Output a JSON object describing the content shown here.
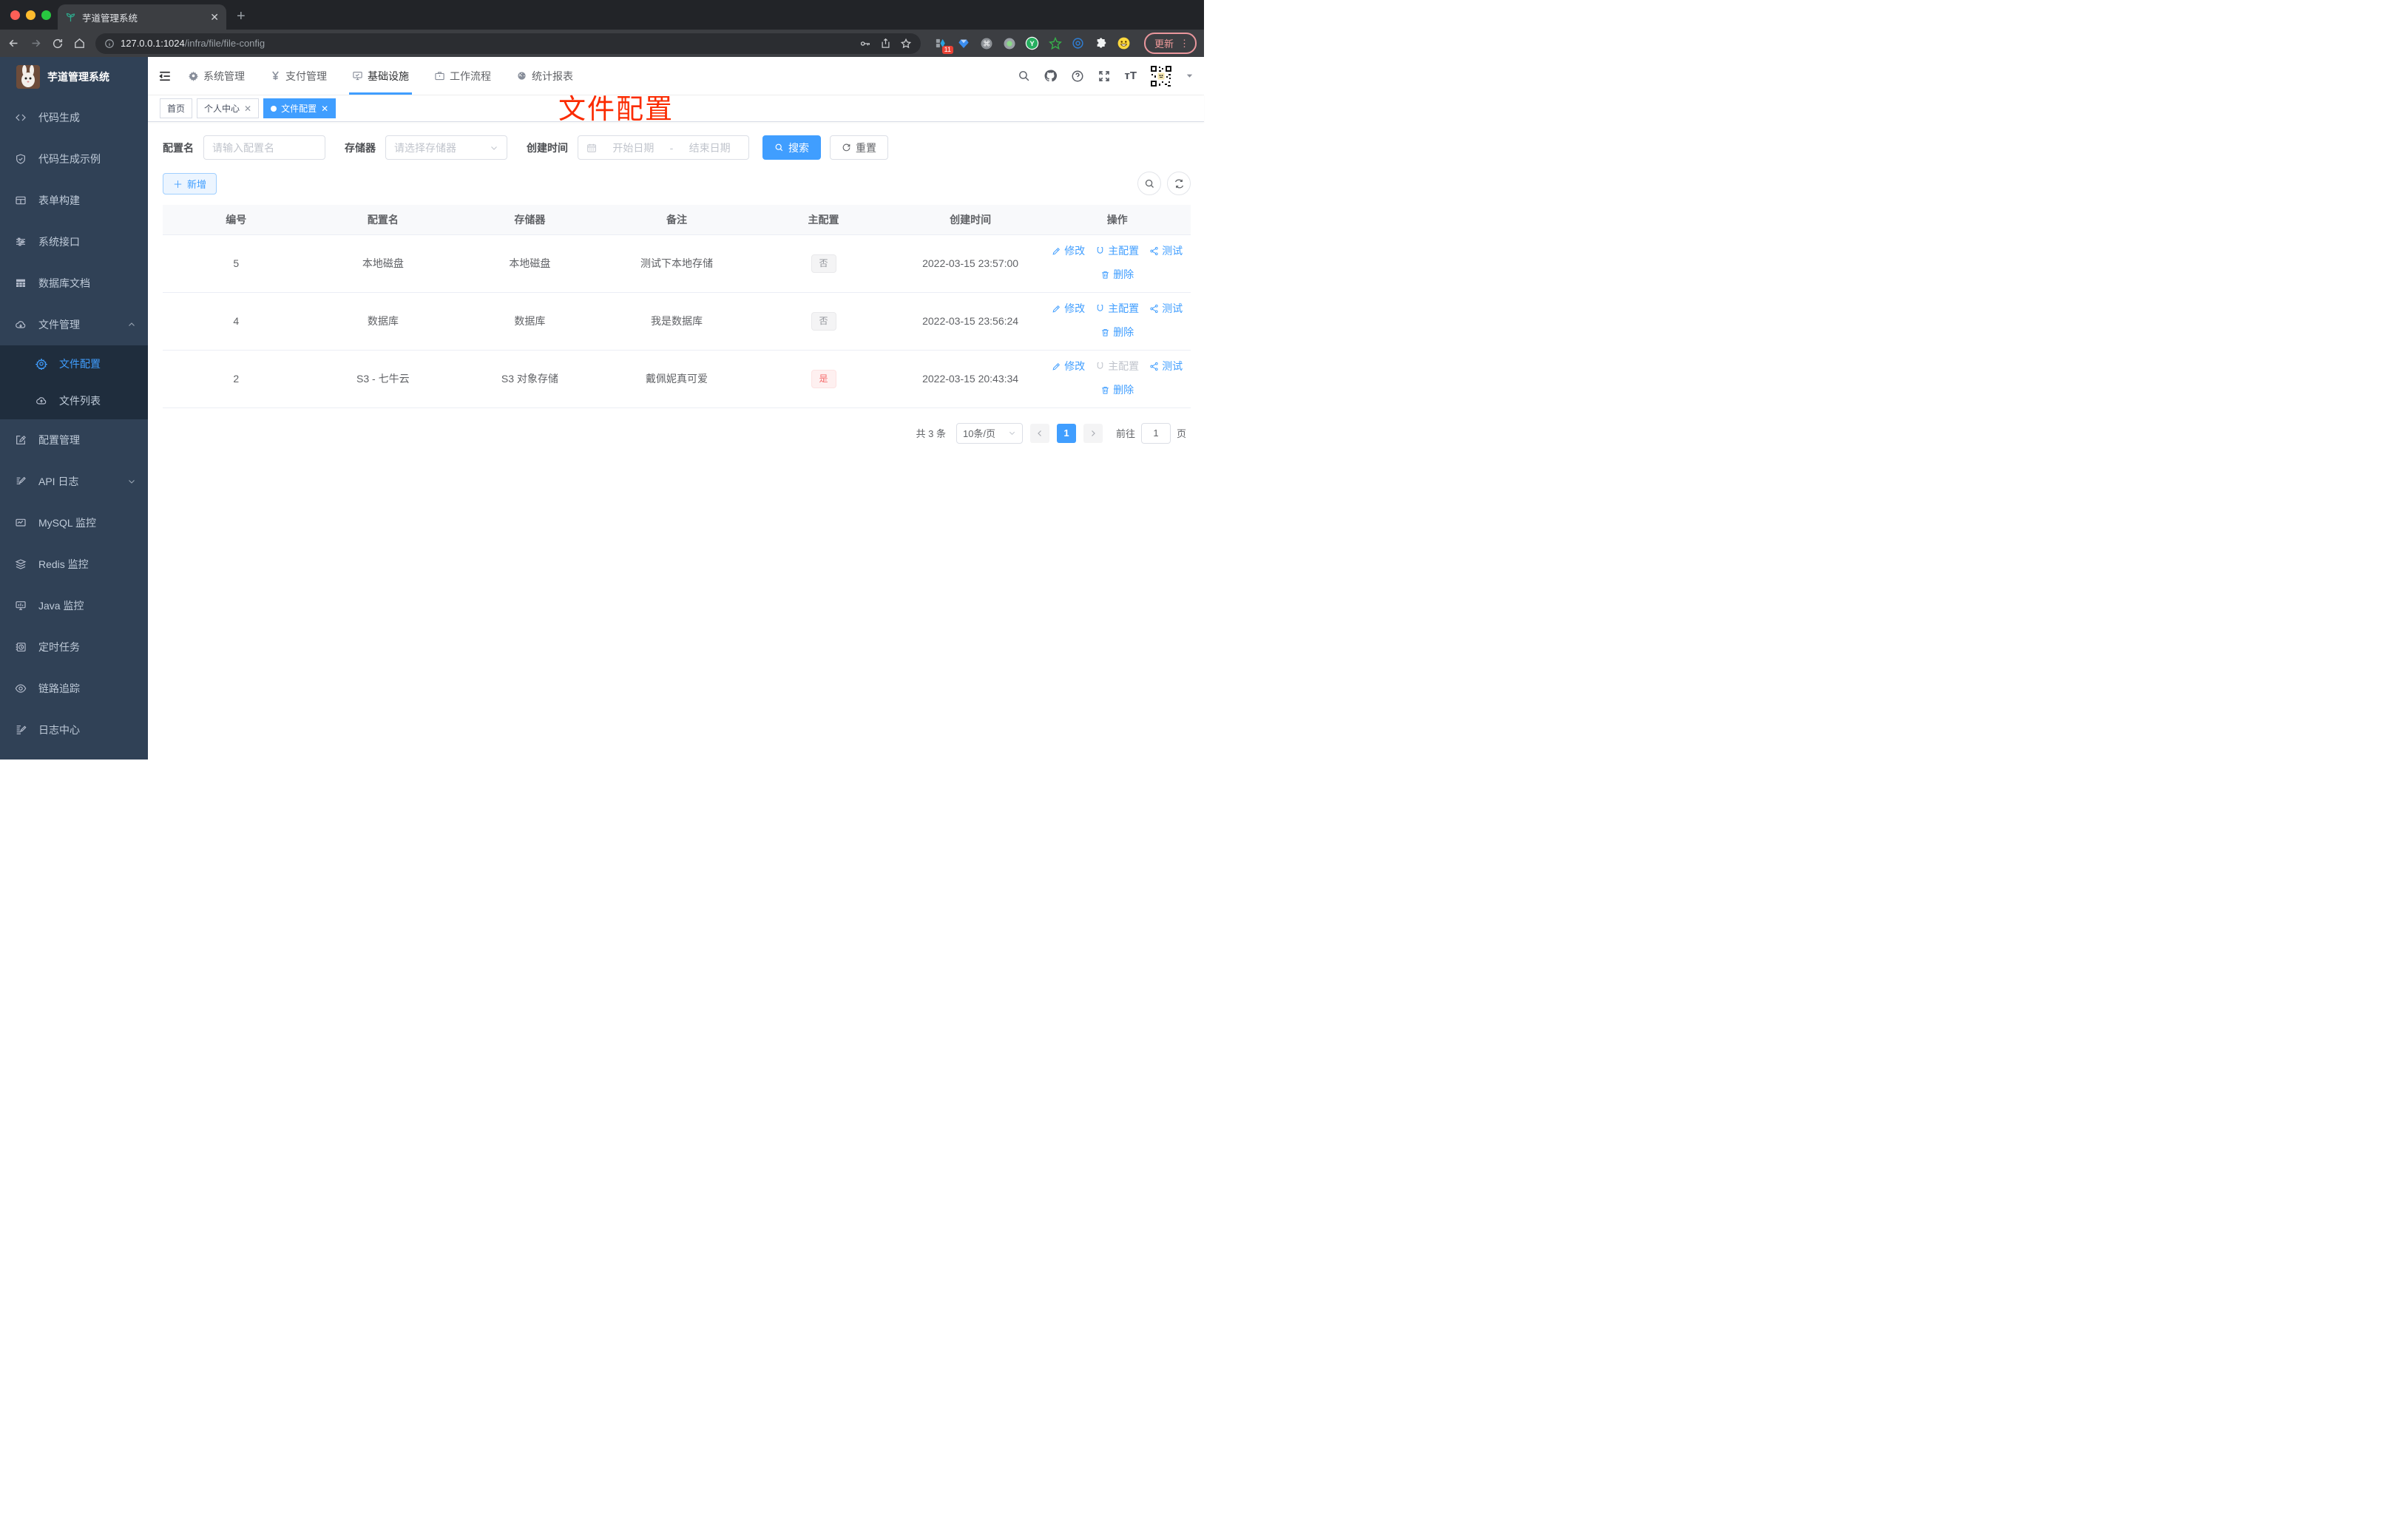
{
  "browser": {
    "tab_title": "芋道管理系统",
    "url_host": "127.0.0.1:1024",
    "url_path": "/infra/file/file-config",
    "extension_badge": "11",
    "update_label": "更新"
  },
  "sidebar": {
    "title": "芋道管理系统",
    "items": [
      {
        "icon": "code-icon",
        "label": "代码生成"
      },
      {
        "icon": "shield-check-icon",
        "label": "代码生成示例"
      },
      {
        "icon": "form-icon",
        "label": "表单构建"
      },
      {
        "icon": "sliders-icon",
        "label": "系统接口"
      },
      {
        "icon": "db-table-icon",
        "label": "数据库文档"
      },
      {
        "icon": "cloud-download-icon",
        "label": "文件管理"
      },
      {
        "icon": "edit-square-icon",
        "label": "配置管理"
      },
      {
        "icon": "doc-edit-icon",
        "label": "API 日志"
      },
      {
        "icon": "mysql-monitor-icon",
        "label": "MySQL 监控"
      },
      {
        "icon": "redis-stack-icon",
        "label": "Redis 监控"
      },
      {
        "icon": "java-monitor-icon",
        "label": "Java 监控"
      },
      {
        "icon": "timer-task-icon",
        "label": "定时任务"
      },
      {
        "icon": "eye-icon",
        "label": "链路追踪"
      },
      {
        "icon": "log-center-icon",
        "label": "日志中心"
      }
    ],
    "submenu": [
      {
        "icon": "gear-icon",
        "label": "文件配置",
        "active": true
      },
      {
        "icon": "cloud-upload-icon",
        "label": "文件列表"
      }
    ]
  },
  "topnav": {
    "items": [
      {
        "icon": "gear-icon",
        "label": "系统管理"
      },
      {
        "icon": "yen-icon",
        "label": "支付管理"
      },
      {
        "icon": "infra-icon",
        "label": "基础设施",
        "active": true
      },
      {
        "icon": "briefcase-icon",
        "label": "工作流程"
      },
      {
        "icon": "dashboard-icon",
        "label": "统计报表"
      }
    ]
  },
  "tags": [
    {
      "label": "首页",
      "closable": false,
      "active": false
    },
    {
      "label": "个人中心",
      "closable": true,
      "active": false
    },
    {
      "label": "文件配置",
      "closable": true,
      "active": true
    }
  ],
  "annotation": "文件配置",
  "filters": {
    "name_label": "配置名",
    "name_placeholder": "请输入配置名",
    "storage_label": "存储器",
    "storage_placeholder": "请选择存储器",
    "time_label": "创建时间",
    "start_placeholder": "开始日期",
    "range_separator": "-",
    "end_placeholder": "结束日期",
    "search_label": "搜索",
    "reset_label": "重置"
  },
  "toolbar": {
    "add_label": "新增"
  },
  "table": {
    "headers": [
      "编号",
      "配置名",
      "存储器",
      "备注",
      "主配置",
      "创建时间",
      "操作"
    ],
    "rows": [
      {
        "id": "5",
        "name": "本地磁盘",
        "storage": "本地磁盘",
        "remark": "测试下本地存储",
        "master": "否",
        "master_type": "info",
        "time": "2022-03-15 23:57:00"
      },
      {
        "id": "4",
        "name": "数据库",
        "storage": "数据库",
        "remark": "我是数据库",
        "master": "否",
        "master_type": "info",
        "time": "2022-03-15 23:56:24"
      },
      {
        "id": "2",
        "name": "S3 - 七牛云",
        "storage": "S3 对象存储",
        "remark": "戴佩妮真可爱",
        "master": "是",
        "master_type": "danger",
        "time": "2022-03-15 20:43:34"
      }
    ],
    "actions": {
      "edit": "修改",
      "master": "主配置",
      "test": "测试",
      "delete": "删除"
    }
  },
  "pagination": {
    "total": "共 3 条",
    "page_size": "10条/页",
    "page": "1",
    "goto_label": "前往",
    "goto_value": "1",
    "page_unit": "页"
  },
  "colors": {
    "primary": "#409eff",
    "danger": "#f56c6c",
    "annotation_red": "#fb2b01",
    "sidebar_bg": "#304156",
    "submenu_bg": "#1f2d3d"
  }
}
